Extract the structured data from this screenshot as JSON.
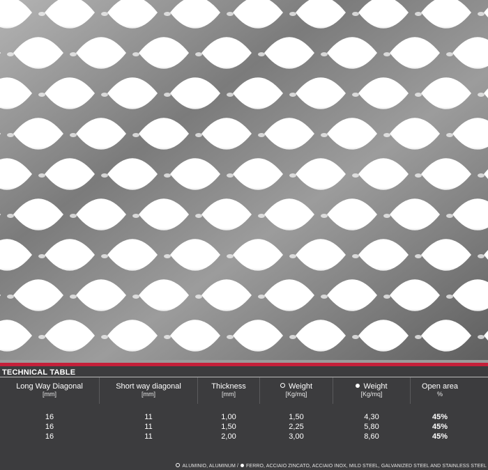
{
  "panel_title": "TECHNICAL TABLE",
  "columns": [
    {
      "label": "Long Way Diagonal",
      "unit": "[mm]"
    },
    {
      "label": "Short way diagonal",
      "unit": "[mm]"
    },
    {
      "label": "Thickness",
      "unit": "[mm]"
    },
    {
      "label": "Weight",
      "unit": "[Kg/mq]",
      "marker": "open-circle-icon"
    },
    {
      "label": "Weight",
      "unit": "[Kg/mq]",
      "marker": "filled-circle-icon"
    },
    {
      "label": "Open area",
      "unit": "%"
    }
  ],
  "rows": [
    [
      "16",
      "11",
      "1,00",
      "1,50",
      "4,30",
      "45%"
    ],
    [
      "16",
      "11",
      "1,50",
      "2,25",
      "5,80",
      "45%"
    ],
    [
      "16",
      "11",
      "2,00",
      "3,00",
      "8,60",
      "45%"
    ]
  ],
  "legend": {
    "open_label": "ALUMINIO, ALUMINUM /",
    "filled_label": "FERRO, ACCIAIO ZINCATO, ACCIAIO INOX, MILD STEEL, GALVANIZED STEEL AND STAINLESS STEEL"
  },
  "colors": {
    "accent": "#c5203a",
    "panel_bg": "#3c3c3e",
    "mesh_metal": "#8a8a8a"
  }
}
